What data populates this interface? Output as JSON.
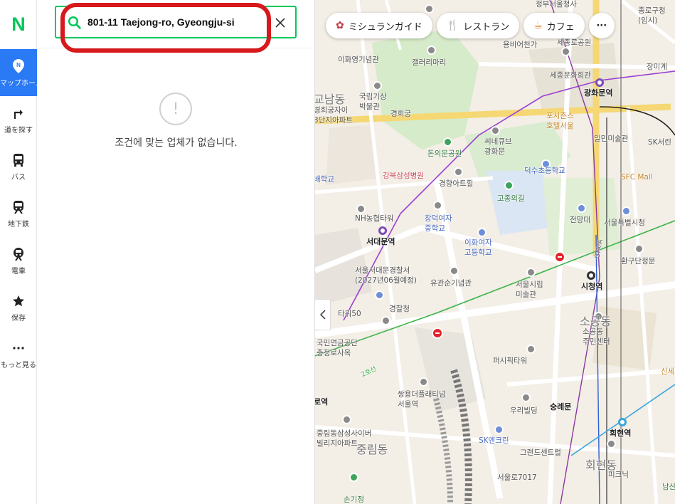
{
  "rail": {
    "logo": "N",
    "items": [
      {
        "label": "マップホーム",
        "icon": "map-pin-icon"
      },
      {
        "label": "道を探す",
        "icon": "directions-icon"
      },
      {
        "label": "バス",
        "icon": "bus-icon"
      },
      {
        "label": "地下鉄",
        "icon": "subway-icon"
      },
      {
        "label": "電車",
        "icon": "train-icon"
      },
      {
        "label": "保存",
        "icon": "star-icon"
      },
      {
        "label": "もっと見る",
        "icon": "more-icon"
      }
    ]
  },
  "search": {
    "value": "801-11 Taejong-ro, Gyeongju-si",
    "empty_message": "조건에 맞는 업체가 없습니다."
  },
  "chips": [
    {
      "label": "ミシュランガイド",
      "icon": "michelin-icon"
    },
    {
      "label": "レストラン",
      "icon": "restaurant-icon"
    },
    {
      "label": "カフェ",
      "icon": "cafe-icon"
    }
  ],
  "map": {
    "labels": {
      "l1": "이화영기념관",
      "l2": "갤러리마리",
      "l3": "국립기상\n박물관",
      "l4": "경희궁",
      "l5": "돈의문공원",
      "l6": "씨네큐브\n광화문",
      "l7": "강북삼성병원",
      "l8": "경향아트힐",
      "l9": "고종의길",
      "l10": "덕수초등학교",
      "l11": "NH농협타워",
      "l12": "창덕여자\n중학교",
      "l13": "이화여자\n고등학교",
      "l14": "서대문역",
      "l15": "서울서대문경찰서\n(2027년06월예정)",
      "l16": "유관순기념관",
      "l17": "서울시립\n미술관",
      "l18": "시청역",
      "l19": "타워50",
      "l20": "경찰청",
      "l21": "국민연금공단\n충정로사옥",
      "l22": "퍼시픽타워",
      "l23": "숭례문",
      "l24": "쌍용더플래티넘\n서울역",
      "l25": "우리빌딩",
      "l26": "SK엔크린",
      "l27": "그랜드센트럴",
      "l28": "회현역",
      "l29": "중림동삼성사이버\n빌리지아파트",
      "l30": "중림동",
      "l31": "서울로7017",
      "l32": "손기정",
      "l33": "세종문화회관",
      "l34": "광화문역",
      "l35": "포시즌스\n호텔서울",
      "l36": "일민미술관",
      "l37": "SFC Mall",
      "l38": "서울특별시청",
      "l39": "환구단정문",
      "l40": "전망대",
      "l41": "소공동\n주민센터",
      "l42": "회현동",
      "l43": "피크닉",
      "l44": "정부서울청사",
      "l45": "종로구청\n(임시)",
      "l46": "장미계",
      "l47": "SK서린",
      "l48": "용비어천가",
      "l49": "세종로공원",
      "l50": "소공동",
      "l51": "경희궁자이\n3단지아파트",
      "l52": "교남동",
      "l53": "배학교",
      "l54": "로역",
      "l55": "신세",
      "l56": "남산",
      "l57": "2호선",
      "l58": "GTX-A"
    }
  },
  "colors": {
    "brand": "#03c75a",
    "active": "#2a79f5",
    "highlight": "#d7191c"
  }
}
